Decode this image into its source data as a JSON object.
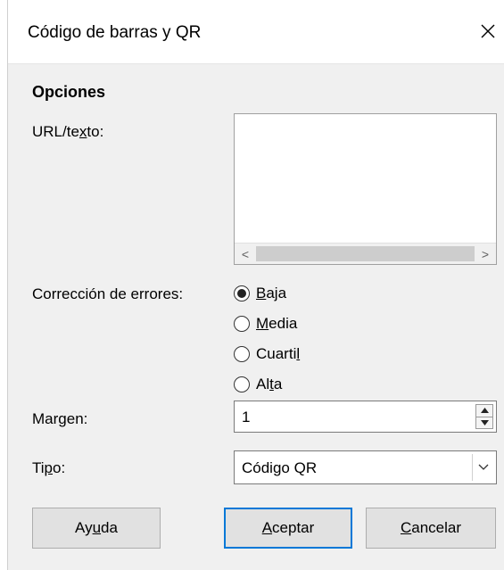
{
  "window": {
    "title": "Código de barras y QR"
  },
  "options": {
    "heading": "Opciones",
    "url_label": {
      "before": "URL/te",
      "accel": "x",
      "after": "to:"
    },
    "scroll_left": "<",
    "scroll_right": ">",
    "error_label": "Corrección de errores:",
    "error_options": [
      {
        "before": "",
        "accel": "B",
        "after": "aja",
        "selected": true
      },
      {
        "before": "",
        "accel": "M",
        "after": "edia",
        "selected": false
      },
      {
        "before": "Cuarti",
        "accel": "l",
        "after": "",
        "selected": false
      },
      {
        "before": "Al",
        "accel": "t",
        "after": "a",
        "selected": false
      }
    ],
    "margin_label": {
      "before": "Mar",
      "accel": "g",
      "after": "en:"
    },
    "margin_value": "1",
    "type_label": {
      "before": "Ti",
      "accel": "p",
      "after": "o:"
    },
    "type_value": "Código QR"
  },
  "buttons": {
    "help": {
      "before": "Ay",
      "accel": "u",
      "after": "da"
    },
    "ok": {
      "before": "",
      "accel": "A",
      "after": "ceptar"
    },
    "cancel": {
      "before": "",
      "accel": "C",
      "after": "ancelar"
    }
  },
  "colors": {
    "focus_border": "#0078d7",
    "dialog_bg": "#f0f0f0"
  }
}
